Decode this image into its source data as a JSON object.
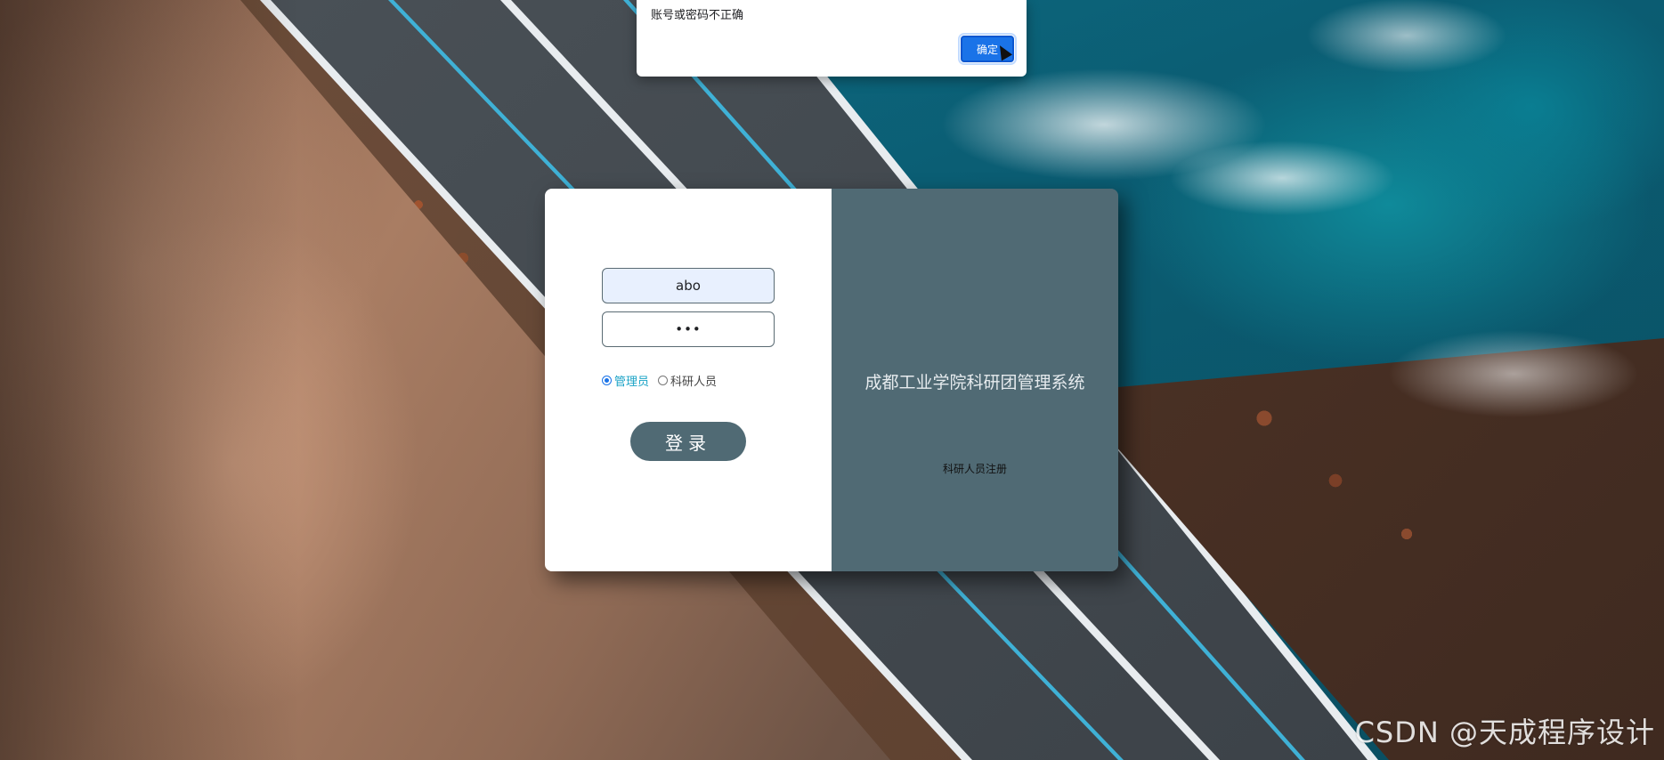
{
  "alert": {
    "message": "账号或密码不正确",
    "ok_label": "确定"
  },
  "login": {
    "username_value": "abo",
    "password_value": "•••",
    "roles": [
      {
        "label": "管理员",
        "selected": true
      },
      {
        "label": "科研人员",
        "selected": false
      }
    ],
    "submit_label": "登录"
  },
  "side": {
    "system_title": "成都工业学院科研团管理系统",
    "register_link": "科研人员注册"
  },
  "watermark": "CSDN @天成程序设计",
  "colors": {
    "panel": "#506a74",
    "accent": "#1a73e8",
    "selected_role": "#1ba3c6"
  }
}
